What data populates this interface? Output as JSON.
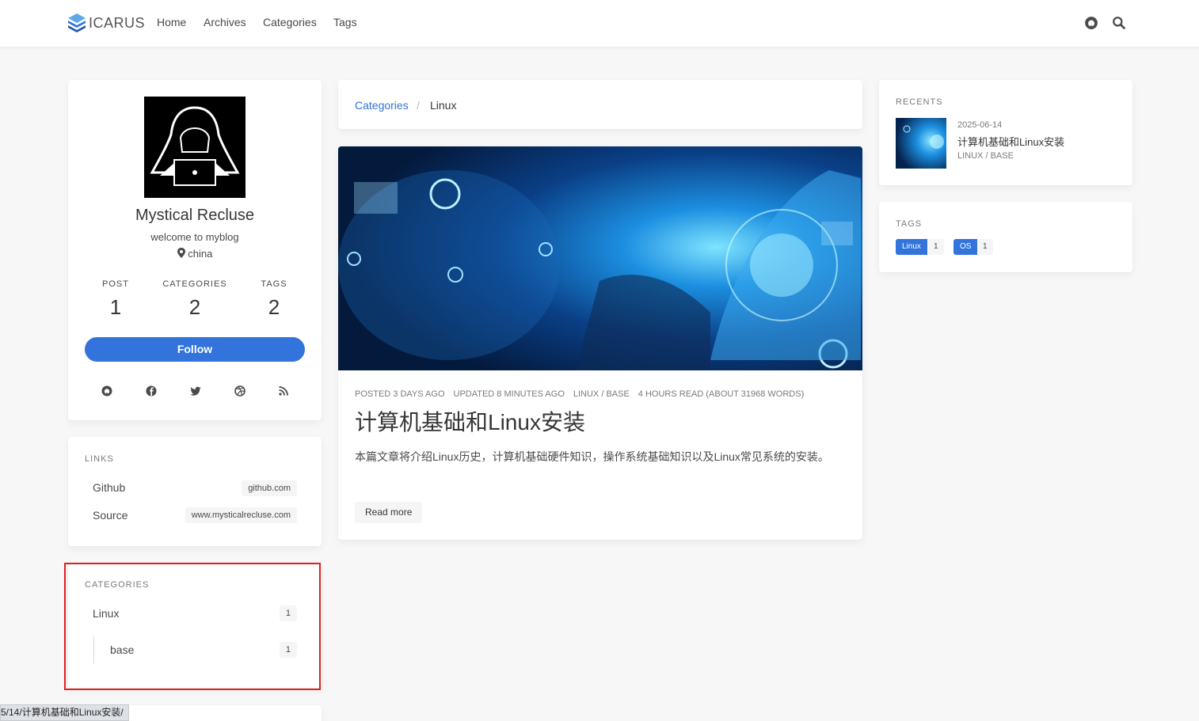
{
  "navbar": {
    "brand": "ICARUS",
    "links": [
      "Home",
      "Archives",
      "Categories",
      "Tags"
    ],
    "icons": [
      "github-icon",
      "search-icon"
    ]
  },
  "profile": {
    "name": "Mystical Recluse",
    "bio": "welcome to myblog",
    "location": "china",
    "stats": [
      {
        "label": "POST",
        "value": "1"
      },
      {
        "label": "CATEGORIES",
        "value": "2"
      },
      {
        "label": "TAGS",
        "value": "2"
      }
    ],
    "follow_label": "Follow",
    "social_icons": [
      "github-icon",
      "facebook-icon",
      "twitter-icon",
      "dribbble-icon",
      "rss-icon"
    ]
  },
  "links_widget": {
    "title": "LINKS",
    "items": [
      {
        "label": "Github",
        "url": "github.com"
      },
      {
        "label": "Source",
        "url": "www.mysticalrecluse.com"
      }
    ]
  },
  "categories_widget": {
    "title": "CATEGORIES",
    "items": [
      {
        "label": "Linux",
        "count": "1"
      },
      {
        "label": "base",
        "count": "1"
      }
    ]
  },
  "breadcrumb": {
    "parent": "Categories",
    "separator": "/",
    "current": "Linux"
  },
  "article": {
    "meta": [
      "POSTED 3 DAYS AGO",
      "UPDATED 8 MINUTES AGO",
      "LINUX / BASE",
      "4 HOURS READ (ABOUT 31968 WORDS)"
    ],
    "title": "计算机基础和Linux安装",
    "excerpt": "本篇文章将介绍Linux历史，计算机基础硬件知识，操作系统基础知识以及Linux常见系统的安装。",
    "read_more": "Read more"
  },
  "recents_widget": {
    "title": "RECENTS",
    "item": {
      "date": "2025-06-14",
      "title": "计算机基础和Linux安装",
      "category": "LINUX / BASE"
    }
  },
  "tags_widget": {
    "title": "TAGS",
    "tags": [
      {
        "name": "Linux",
        "count": "1"
      },
      {
        "name": "OS",
        "count": "1"
      }
    ]
  },
  "status_bar": {
    "url": "5/14/计算机基础和Linux安装/"
  },
  "colors": {
    "accent": "#3273dc",
    "highlight": "#e02020"
  }
}
